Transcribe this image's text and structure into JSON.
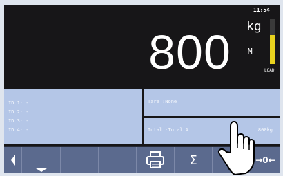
{
  "header": {
    "time": "11:54",
    "weight": "800",
    "unit": "kg",
    "mode": "M",
    "load_label": "LOAD",
    "load_fraction": 0.65
  },
  "ids": [
    {
      "label": "ID 1: -"
    },
    {
      "label": "ID 2: -"
    },
    {
      "label": "ID 3: -"
    },
    {
      "label": "ID 4: -"
    }
  ],
  "tare": {
    "text": "Tare  :None"
  },
  "total": {
    "text": "Total :Total A",
    "value": "800kg"
  },
  "toolbar": {
    "zero_label": "→ 0 ←",
    "sum_label": "Σ"
  },
  "colors": {
    "background": "#171618",
    "panel": "#b4c6e7",
    "button": "#5b6a8e",
    "load_fill": "#e8d21e"
  },
  "icons": [
    "left-arrow-icon",
    "down-arrow-icon",
    "printer-icon",
    "sigma-icon",
    "tare-arrow-icon",
    "zero-icon",
    "hand-pointer-icon"
  ]
}
